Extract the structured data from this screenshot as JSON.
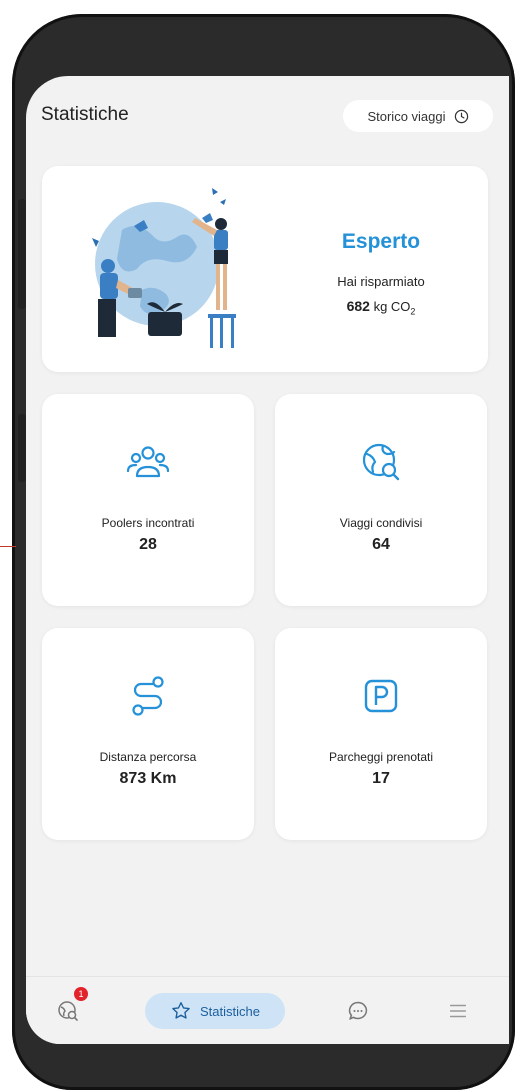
{
  "header": {
    "title": "Statistiche",
    "history_button": "Storico viaggi"
  },
  "summary": {
    "level": "Esperto",
    "saved_label": "Hai risparmiato",
    "saved_value": "682",
    "saved_unit": "kg CO",
    "saved_unit_sub": "2"
  },
  "stats": [
    {
      "label": "Poolers incontrati",
      "value": "28",
      "icon": "people-icon"
    },
    {
      "label": "Viaggi condivisi",
      "value": "64",
      "icon": "globe-search-icon"
    },
    {
      "label": "Distanza percorsa",
      "value": "873 Km",
      "icon": "route-icon"
    },
    {
      "label": "Parcheggi prenotati",
      "value": "17",
      "icon": "parking-icon"
    }
  ],
  "nav": {
    "badge_count": "1",
    "active_label": "Statistiche"
  },
  "colors": {
    "accent": "#2491d8",
    "active_pill": "#cfe3f6",
    "badge": "#e2232c"
  }
}
